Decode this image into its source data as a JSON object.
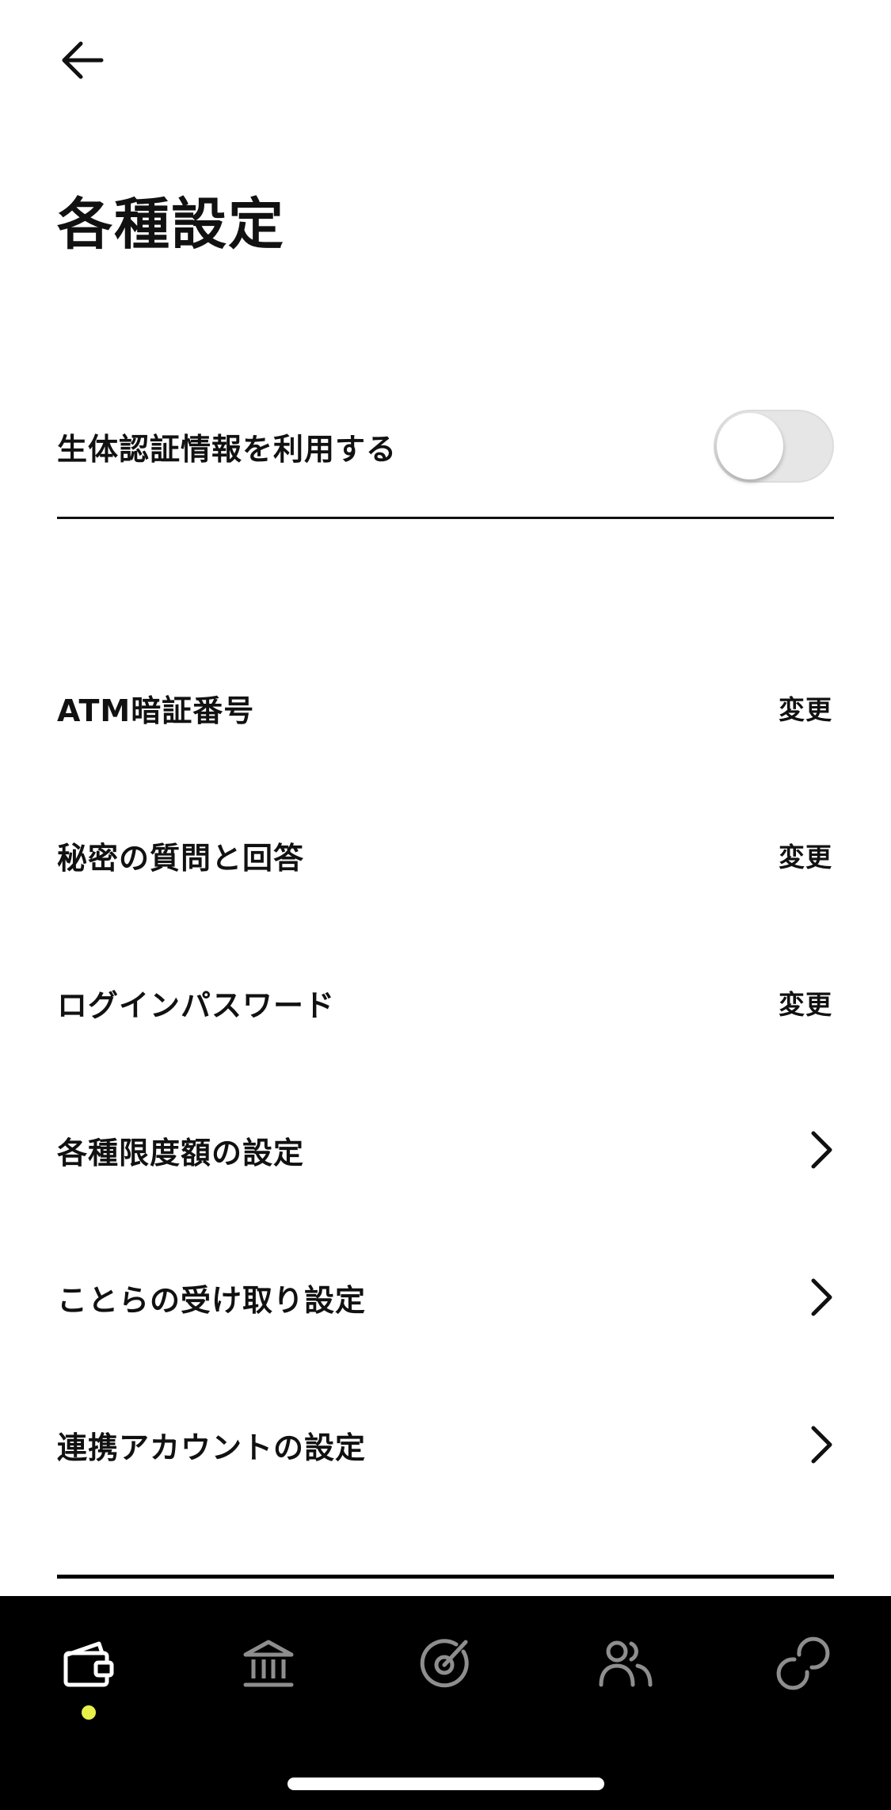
{
  "header": {
    "back_icon": "arrow-left-icon",
    "title": "各種設定"
  },
  "biometric": {
    "label": "生体認証情報を利用する",
    "enabled": false
  },
  "settings": {
    "atm_pin": {
      "label": "ATM暗証番号",
      "action": "変更"
    },
    "secret_question": {
      "label": "秘密の質問と回答",
      "action": "変更"
    },
    "login_password": {
      "label": "ログインパスワード",
      "action": "変更"
    },
    "limits": {
      "label": "各種限度額の設定",
      "icon": "chevron-right-icon"
    },
    "kotora": {
      "label": "ことらの受け取り設定",
      "icon": "chevron-right-icon"
    },
    "linked_accounts": {
      "label": "連携アカウントの設定",
      "icon": "chevron-right-icon"
    }
  },
  "bottom_nav": {
    "items": [
      {
        "icon": "wallet-icon",
        "active": true
      },
      {
        "icon": "bank-icon",
        "active": false
      },
      {
        "icon": "target-icon",
        "active": false
      },
      {
        "icon": "people-icon",
        "active": false
      },
      {
        "icon": "link-icon",
        "active": false
      }
    ]
  },
  "colors": {
    "active_nav_icon": "#ffffff",
    "inactive_nav_icon": "#8e8e8e",
    "active_dot": "#e8f04a",
    "nav_background": "#000000",
    "toggle_off_track": "#e6e6e6"
  }
}
